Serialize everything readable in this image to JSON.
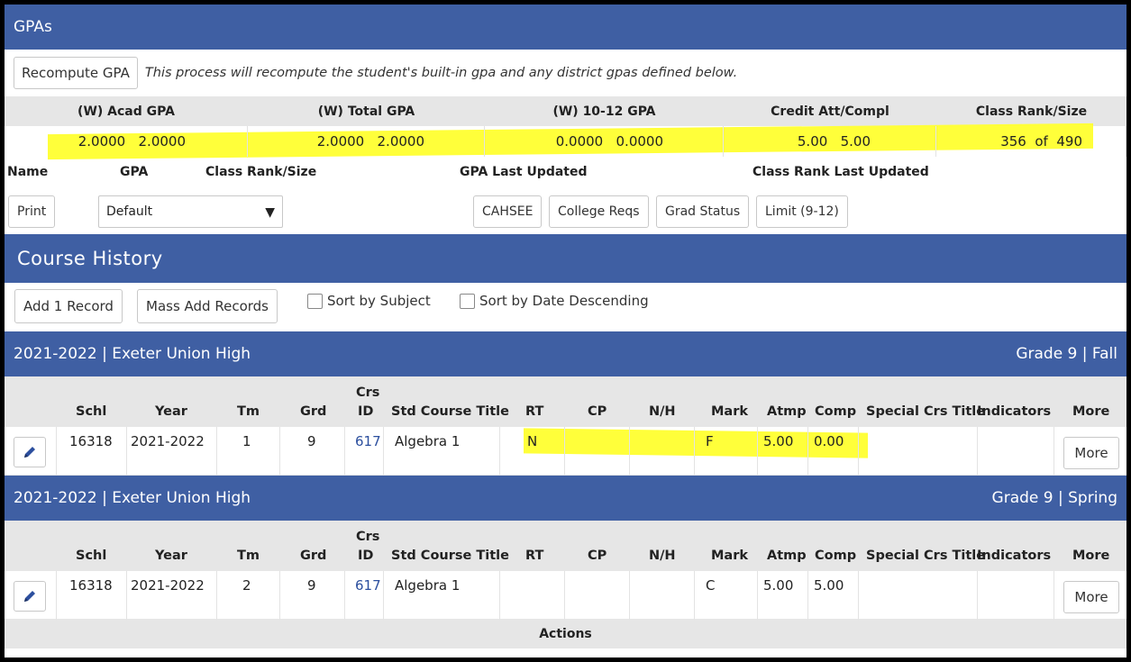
{
  "gpas": {
    "title": "GPAs",
    "recompute_label": "Recompute GPA",
    "recompute_note": "This process will recompute the student's built-in gpa and any district gpas defined below.",
    "headers": [
      "(W) Acad GPA",
      "(W) Total GPA",
      "(W) 10-12 GPA",
      "Credit Att/Compl",
      "Class Rank/Size"
    ],
    "values": [
      "2.0000   2.0000",
      "2.0000   2.0000",
      "0.0000   0.0000",
      "5.00   5.00",
      "356  of  490"
    ]
  },
  "gpa_table": {
    "headers": [
      "Name",
      "GPA",
      "Class Rank/Size",
      "GPA Last Updated",
      "Class Rank Last Updated"
    ],
    "print_label": "Print",
    "select_value": "Default",
    "buttons": [
      "CAHSEE",
      "College Reqs",
      "Grad Status",
      "Limit (9-12)"
    ]
  },
  "course_history": {
    "title": "Course History",
    "add_label": "Add 1 Record",
    "mass_add_label": "Mass Add Records",
    "sort_subject_label": "Sort by Subject",
    "sort_date_label": "Sort by Date Descending",
    "columns": {
      "schl": "Schl",
      "year": "Year",
      "tm": "Tm",
      "grd": "Grd",
      "crs_id_top": "Crs",
      "crs_id_bottom": "ID",
      "title": "Std Course Title",
      "rt": "RT",
      "cp": "CP",
      "nh": "N/H",
      "mark": "Mark",
      "atmp": "Atmp",
      "comp": "Comp",
      "special": "Special Crs Title",
      "indicators": "Indicators",
      "more": "More"
    },
    "terms": [
      {
        "school_year": "2021-2022 | Exeter Union High",
        "grade_term": "Grade 9 | Fall",
        "row": {
          "schl": "16318",
          "year": "2021-2022",
          "tm": "1",
          "grd": "9",
          "crs_id": "617",
          "title": "Algebra 1",
          "rt": "N",
          "cp": "",
          "nh": "",
          "mark": "F",
          "atmp": "5.00",
          "comp": "0.00",
          "more": "More"
        }
      },
      {
        "school_year": "2021-2022 | Exeter Union High",
        "grade_term": "Grade 9 | Spring",
        "row": {
          "schl": "16318",
          "year": "2021-2022",
          "tm": "2",
          "grd": "9",
          "crs_id": "617",
          "title": "Algebra 1",
          "rt": "",
          "cp": "",
          "nh": "",
          "mark": "C",
          "atmp": "5.00",
          "comp": "5.00",
          "more": "More"
        }
      }
    ],
    "actions_label": "Actions"
  },
  "colors": {
    "header_blue": "#3f5fa3",
    "highlight": "#ffff3a",
    "link": "#2c4f9e"
  }
}
